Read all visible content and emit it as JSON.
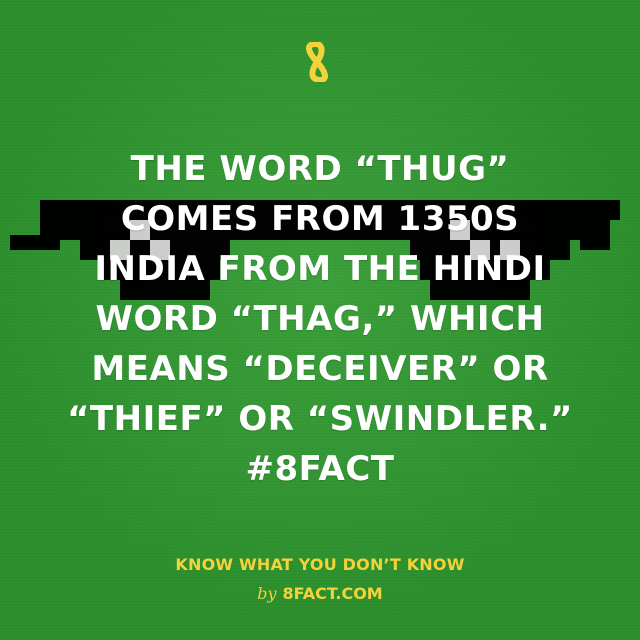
{
  "brand": {
    "logo_icon": "infinity-8-icon",
    "logo_color": "#f4d33a"
  },
  "decor": {
    "background_color": "#2f9a2f",
    "glasses_icon": "pixel-sunglasses-icon",
    "glasses_color": "#000000",
    "glasses_highlight_color": "#cfcfcf"
  },
  "fact": {
    "lines": [
      "THE WORD “THUG”",
      "COMES FROM 1350S",
      "INDIA FROM THE HINDI",
      "WORD “THAG,” WHICH",
      "MEANS “DECEIVER” OR",
      "“THIEF” OR “SWINDLER.”",
      "#8FACT"
    ],
    "text_color": "#ffffff"
  },
  "footer": {
    "tagline": "KNOW WHAT YOU DON’T KNOW",
    "by": "by",
    "site": "8FACT.COM",
    "text_color": "#f4d33a"
  }
}
